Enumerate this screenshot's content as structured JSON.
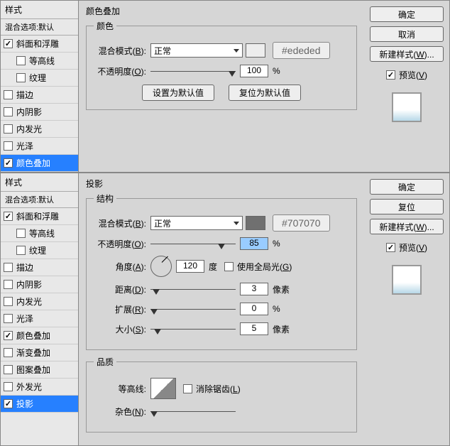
{
  "dialog1": {
    "sidebar": {
      "header": "样式",
      "subheader": "混合选项:默认",
      "items": [
        {
          "label": "斜面和浮雕",
          "checked": true,
          "indent": false
        },
        {
          "label": "等高线",
          "checked": false,
          "indent": true
        },
        {
          "label": "纹理",
          "checked": false,
          "indent": true
        },
        {
          "label": "描边",
          "checked": false,
          "indent": false
        },
        {
          "label": "内阴影",
          "checked": false,
          "indent": false
        },
        {
          "label": "内发光",
          "checked": false,
          "indent": false
        },
        {
          "label": "光泽",
          "checked": false,
          "indent": false
        },
        {
          "label": "颜色叠加",
          "checked": true,
          "indent": false,
          "selected": true
        }
      ]
    },
    "title": "颜色叠加",
    "groupTitle": "颜色",
    "blendModeLabel": "混合模式(B):",
    "blendModeValue": "正常",
    "hex": "#ededed",
    "opacityLabel": "不透明度(O):",
    "opacityValue": "100",
    "opacityUnit": "%",
    "btnDefault": "设置为默认值",
    "btnReset": "复位为默认值",
    "right": {
      "ok": "确定",
      "cancel": "取消",
      "newStyle": "新建样式(W)...",
      "preview": "预览(V)"
    }
  },
  "dialog2": {
    "sidebar": {
      "header": "样式",
      "subheader": "混合选项:默认",
      "items": [
        {
          "label": "斜面和浮雕",
          "checked": true,
          "indent": false
        },
        {
          "label": "等高线",
          "checked": false,
          "indent": true
        },
        {
          "label": "纹理",
          "checked": false,
          "indent": true
        },
        {
          "label": "描边",
          "checked": false,
          "indent": false
        },
        {
          "label": "内阴影",
          "checked": false,
          "indent": false
        },
        {
          "label": "内发光",
          "checked": false,
          "indent": false
        },
        {
          "label": "光泽",
          "checked": false,
          "indent": false
        },
        {
          "label": "颜色叠加",
          "checked": true,
          "indent": false
        },
        {
          "label": "渐变叠加",
          "checked": false,
          "indent": false
        },
        {
          "label": "图案叠加",
          "checked": false,
          "indent": false
        },
        {
          "label": "外发光",
          "checked": false,
          "indent": false
        },
        {
          "label": "投影",
          "checked": true,
          "indent": false,
          "selected": true
        }
      ]
    },
    "title": "投影",
    "groupStruct": "结构",
    "blendModeLabel": "混合模式(B):",
    "blendModeValue": "正常",
    "hex": "#707070",
    "opacityLabel": "不透明度(O):",
    "opacityValue": "85",
    "opacityUnit": "%",
    "angleLabel": "角度(A):",
    "angleValue": "120",
    "angleUnit": "度",
    "globalLight": "使用全局光(G)",
    "distanceLabel": "距离(D):",
    "distanceValue": "3",
    "distanceUnit": "像素",
    "spreadLabel": "扩展(R):",
    "spreadValue": "0",
    "spreadUnit": "%",
    "sizeLabel": "大小(S):",
    "sizeValue": "5",
    "sizeUnit": "像素",
    "groupQuality": "品质",
    "contourLabel": "等高线:",
    "antialias": "消除锯齿(L)",
    "noiseLabel": "杂色(N):",
    "right": {
      "ok": "确定",
      "reset": "复位",
      "newStyle": "新建样式(W)...",
      "preview": "预览(V)"
    }
  }
}
